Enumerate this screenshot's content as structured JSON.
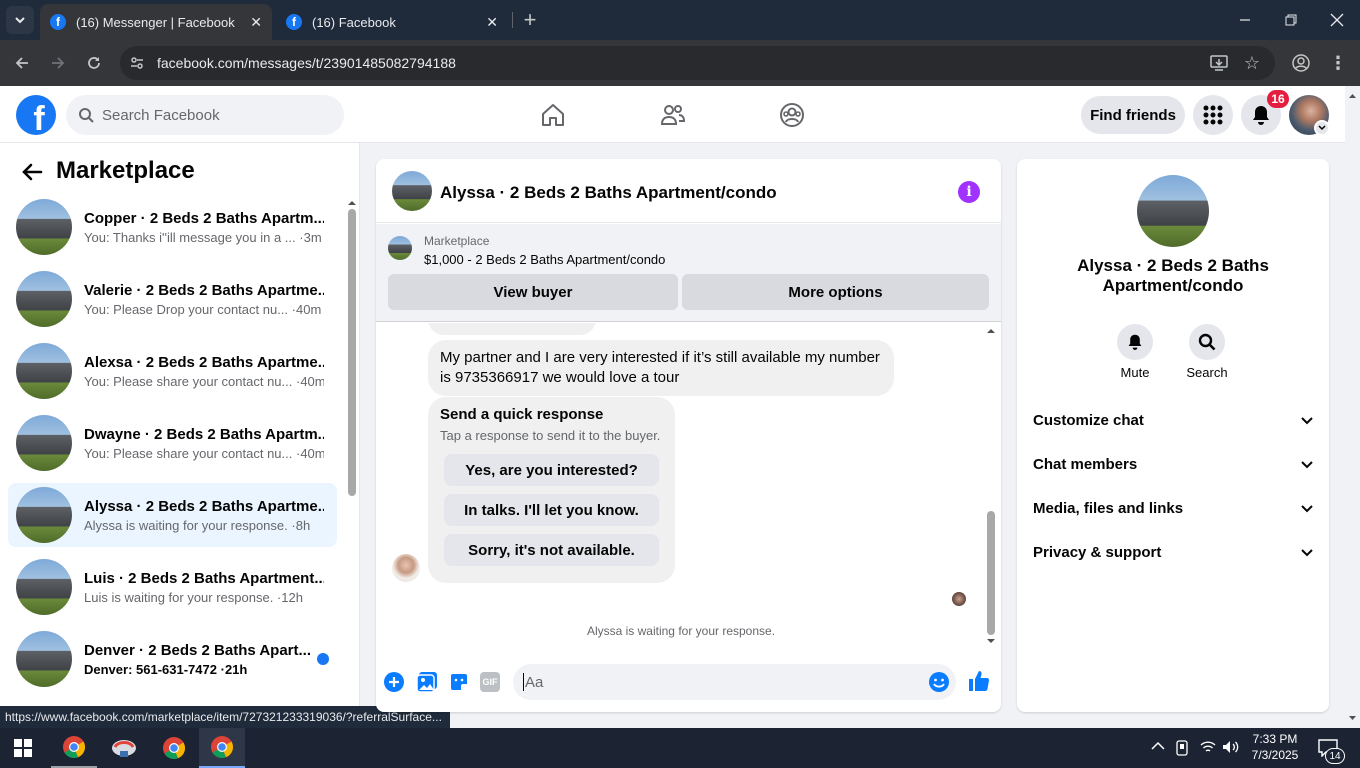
{
  "browser": {
    "tabs": [
      {
        "title": "(16) Messenger | Facebook"
      },
      {
        "title": "(16) Facebook"
      }
    ],
    "url": "facebook.com/messages/t/23901485082794188",
    "status_url": "https://www.facebook.com/marketplace/item/727321233319036/?referralSurface..."
  },
  "fb": {
    "search_placeholder": "Search Facebook",
    "find_friends": "Find friends",
    "notification_count": "16"
  },
  "sidebar": {
    "title": "Marketplace",
    "conversations": [
      {
        "name": "Copper · 2 Beds 2 Baths Apartm...",
        "preview": "You: Thanks i''ill message you in a ...",
        "time": "3m",
        "unread": false
      },
      {
        "name": "Valerie · 2 Beds 2 Baths Apartme...",
        "preview": "You: Please Drop your contact nu...",
        "time": "40m",
        "unread": false
      },
      {
        "name": "Alexsa · 2 Beds 2 Baths Apartme...",
        "preview": "You: Please share your contact nu...",
        "time": "40m",
        "unread": false
      },
      {
        "name": "Dwayne · 2 Beds 2 Baths Apartm...",
        "preview": "You: Please share your contact nu...",
        "time": "40m",
        "unread": false
      },
      {
        "name": "Alyssa · 2 Beds 2 Baths Apartme...",
        "preview": "Alyssa is waiting for your response.",
        "time": "8h",
        "unread": false
      },
      {
        "name": "Luis · 2 Beds 2 Baths Apartment...",
        "preview": "Luis is waiting for your response.",
        "time": "12h",
        "unread": false
      },
      {
        "name": "Denver · 2 Beds 2 Baths Apart...",
        "preview": "Denver: 561-631-7472",
        "time": "21h",
        "unread": true
      }
    ]
  },
  "chat": {
    "title": "Alyssa · 2 Beds 2 Baths Apartment/condo",
    "listing_source": "Marketplace",
    "listing_title": "$1,000 - 2 Beds 2 Baths Apartment/condo",
    "view_buyer": "View buyer",
    "more_options": "More options",
    "message": "My partner and I are very interested if it’s still available my number is 9735366917 we would love a tour",
    "quick_title": "Send a quick response",
    "quick_sub": "Tap a response to send it to the buyer.",
    "quick_responses": [
      "Yes, are you interested?",
      "In talks. I'll let you know.",
      "Sorry, it's not available."
    ],
    "waiting": "Alyssa is waiting for your response.",
    "input_placeholder": "Aa"
  },
  "info": {
    "name": "Alyssa · 2 Beds 2 Baths Apartment/condo",
    "mute": "Mute",
    "search": "Search",
    "sections": [
      "Customize chat",
      "Chat members",
      "Media, files and links",
      "Privacy & support"
    ]
  },
  "taskbar": {
    "time": "7:33 PM",
    "date": "7/3/2025",
    "notif": "14"
  },
  "colors": {
    "fb_blue": "#1877f2",
    "info_purple": "#a033ff"
  }
}
